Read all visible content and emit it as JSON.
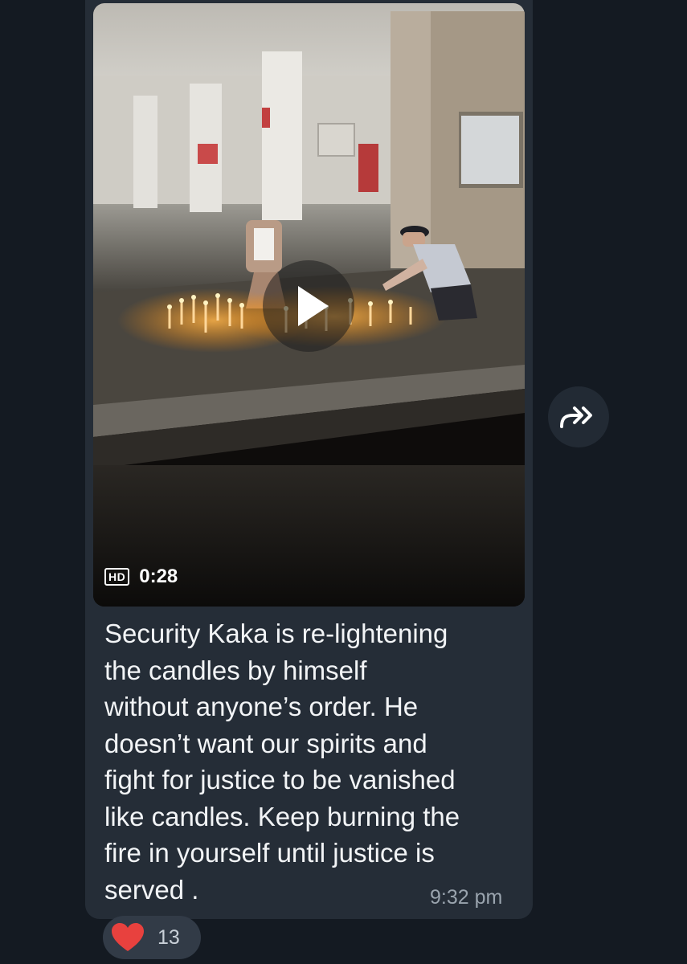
{
  "message": {
    "video": {
      "quality_badge": "HD",
      "duration": "0:28"
    },
    "caption": "Security Kaka is re-lightening\nthe candles by himself\nwithout anyone’s order. He\ndoesn’t want our spirits and\nfight for justice to be vanished\nlike candles. Keep burning the\nfire in yourself until justice is\nserved .",
    "time": "9:32 pm",
    "reaction": {
      "icon": "heart-icon",
      "count": "13"
    },
    "forward": {
      "icon": "forward-arrow-icon"
    }
  },
  "colors": {
    "background": "#141a22",
    "bubble": "#252d37",
    "text": "#f2f4f6",
    "timestamp": "#9aa4ae",
    "reaction_pill": "#323b47",
    "heart": "#e8413e"
  }
}
